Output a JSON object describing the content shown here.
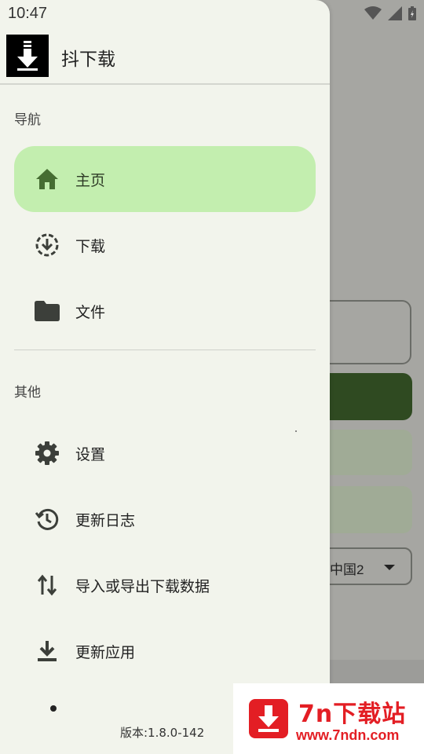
{
  "status_bar": {
    "time": "10:47"
  },
  "app": {
    "title": "抖下载"
  },
  "sections": {
    "navigation_label": "导航",
    "other_label": "其他"
  },
  "nav_items": [
    {
      "label": "主页",
      "icon": "home-icon",
      "active": true
    },
    {
      "label": "下载",
      "icon": "download-circle-icon",
      "active": false
    },
    {
      "label": "文件",
      "icon": "folder-icon",
      "active": false
    }
  ],
  "other_items": [
    {
      "label": "设置",
      "icon": "gear-icon"
    },
    {
      "label": "更新日志",
      "icon": "history-icon"
    },
    {
      "label": "导入或导出下载数据",
      "icon": "import-export-icon"
    },
    {
      "label": "更新应用",
      "icon": "download-tray-icon"
    }
  ],
  "version": "版本:1.8.0-142",
  "background": {
    "select_value": "中国2"
  },
  "watermark": {
    "title": "7n下载站",
    "url": "www.7ndn.com"
  },
  "colors": {
    "active_bg": "#c3eeaf",
    "drawer_bg": "#f2f4ec",
    "primary_dark": "#2f4a21",
    "watermark_red": "#e31e24"
  }
}
